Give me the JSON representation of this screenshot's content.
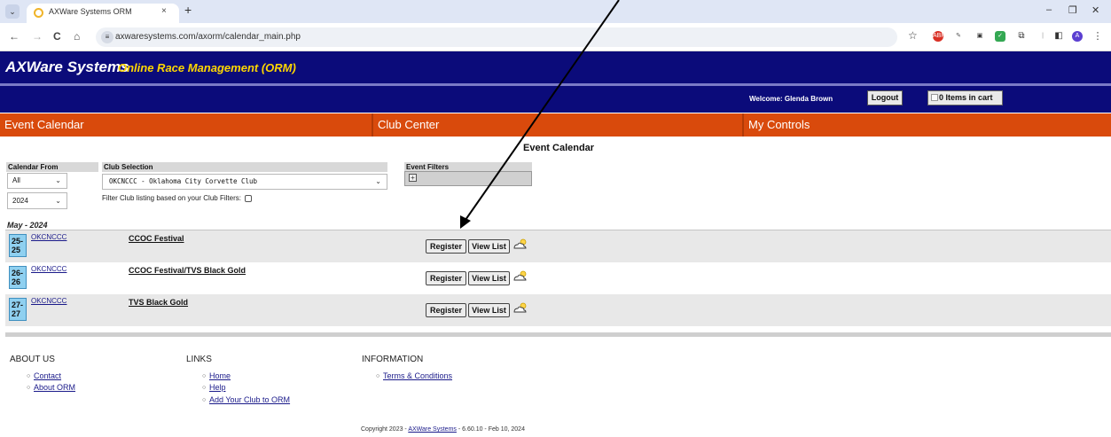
{
  "browser": {
    "tab_title": "AXWare Systems ORM",
    "tab_close": "×",
    "new_tab": "+",
    "tab_menu_icon": "chevron-down-icon",
    "url": "axwaresystems.com/axorm/calendar_main.php",
    "win_minimize": "–",
    "win_restore": "❐",
    "win_close": "✕",
    "nav_back": "←",
    "nav_forward": "→",
    "nav_reload": "C",
    "nav_home": "⌂",
    "bookmark_star": "☆",
    "profile_initial": "A"
  },
  "site": {
    "brand_main": "AXWare Systems",
    "brand_sub": "Online Race Management (ORM)",
    "welcome_text": "Welcome: Glenda Brown",
    "logout_label": "Logout",
    "cart_label": "0 Items in cart"
  },
  "menu": {
    "items": [
      "Event Calendar",
      "Club Center",
      "My Controls"
    ]
  },
  "calendar": {
    "page_title": "Event Calendar",
    "calendar_from_label": "Calendar From",
    "month_select_value": "All",
    "year_select_value": "2024",
    "club_selection_label": "Club Selection",
    "club_select_value": "OKCNCCC - Oklahoma City Corvette Club",
    "filter_note": "Filter Club listing based on your Club Filters:",
    "event_filters_label": "Event Filters",
    "expand_symbol": "+",
    "month_label": "May - 2024",
    "register_label": "Register",
    "view_list_label": "View List",
    "events": [
      {
        "date_top": "25-",
        "date_bottom": "25",
        "club": "OKCNCCC",
        "name": "CCOC Festival"
      },
      {
        "date_top": "26-",
        "date_bottom": "26",
        "club": "OKCNCCC",
        "name": "CCOC Festival/TVS Black Gold"
      },
      {
        "date_top": "27-",
        "date_bottom": "27",
        "club": "OKCNCCC",
        "name": "TVS Black Gold"
      }
    ]
  },
  "footer": {
    "about_heading": "ABOUT US",
    "about_links": [
      "Contact",
      "About ORM"
    ],
    "links_heading": "LINKS",
    "links": [
      "Home",
      "Help",
      "Add Your Club to ORM"
    ],
    "info_heading": "INFORMATION",
    "info_links": [
      "Terms & Conditions"
    ],
    "copyright_prefix": "Copyright 2023 - ",
    "copyright_link": "AXWare Systems",
    "copyright_suffix": " - 6.60.10 - Feb 10, 2024"
  },
  "colors": {
    "header_navy": "#0b0b7a",
    "brand_sub_gold": "#ffd700",
    "menu_orange": "#d94a0c",
    "date_badge_blue": "#8fd0f0"
  }
}
